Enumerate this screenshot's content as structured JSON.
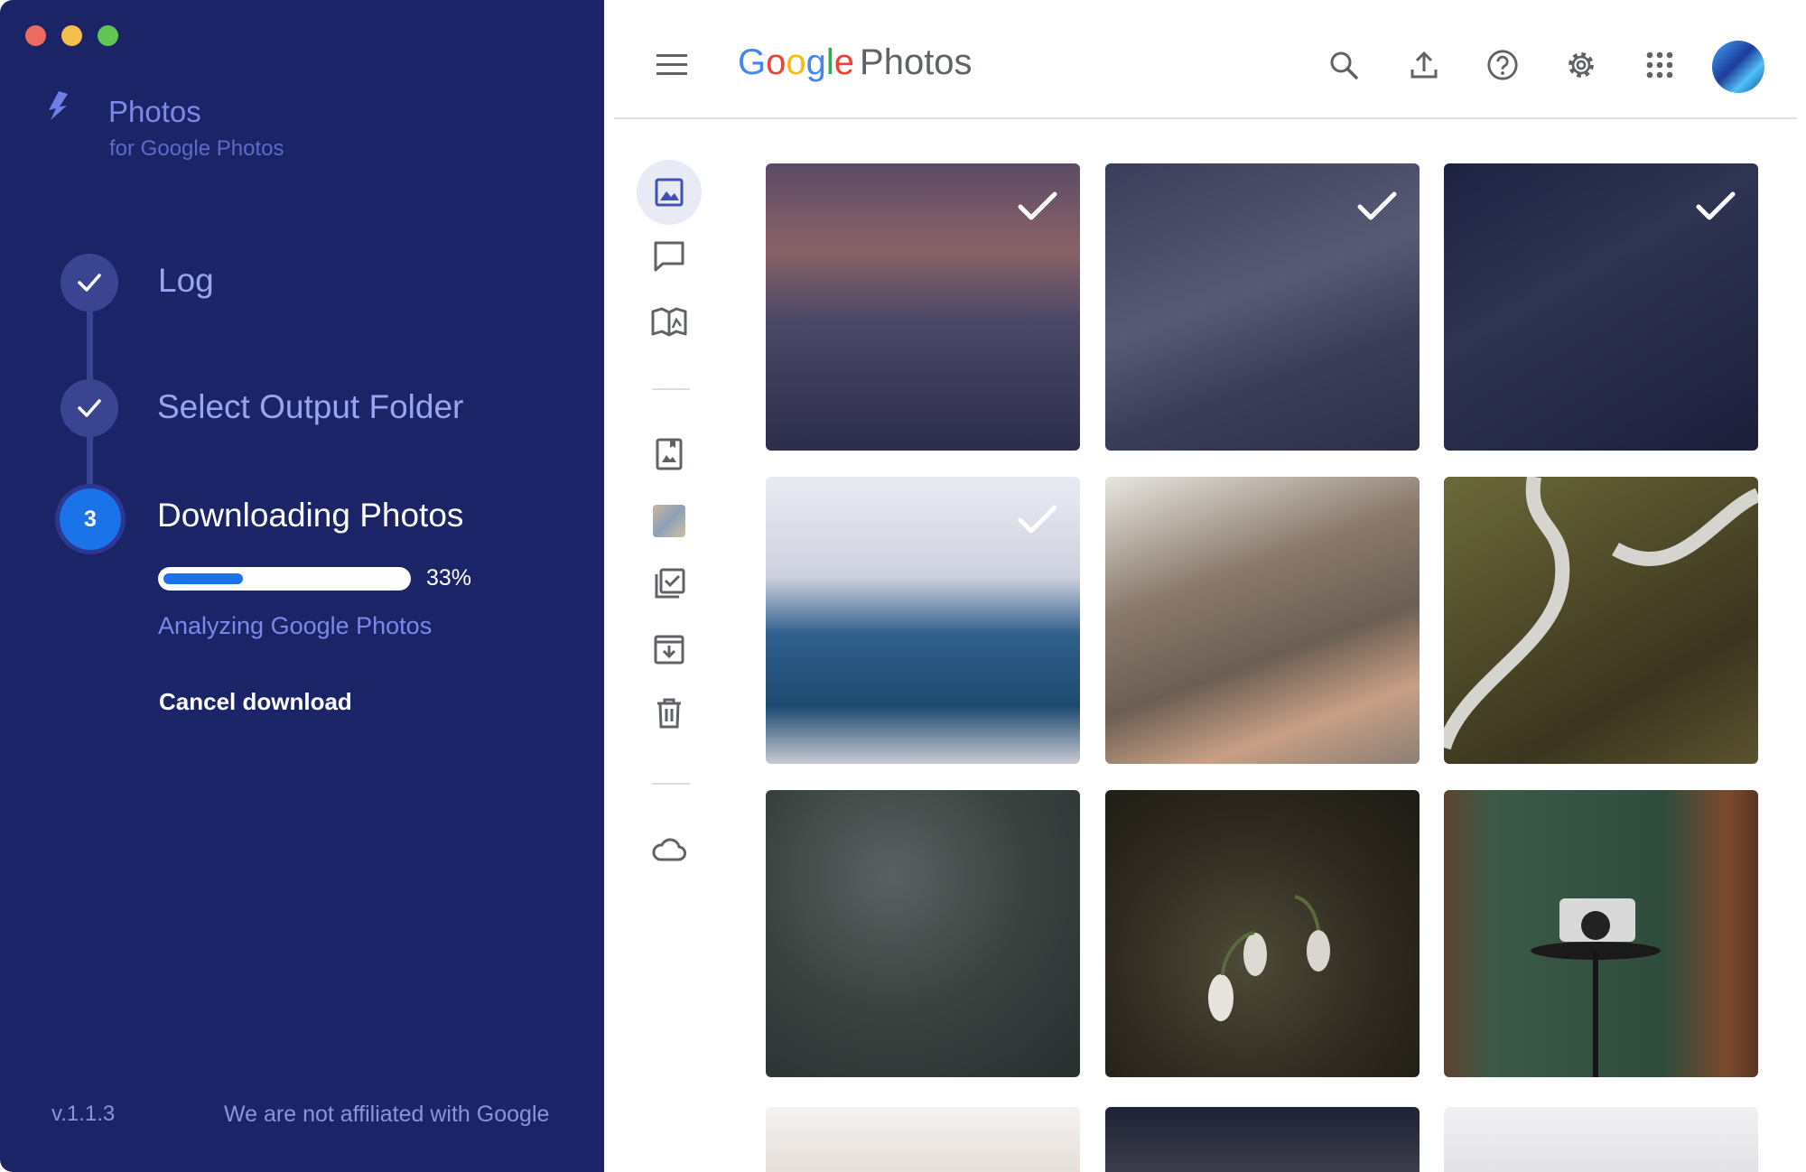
{
  "app": {
    "name": "Photos",
    "subtitle": "for Google Photos",
    "version": "v.1.1.3",
    "disclaimer": "We are not affiliated with Google"
  },
  "steps": [
    {
      "label": "Log",
      "state": "done"
    },
    {
      "label": "Select Output Folder",
      "state": "done"
    },
    {
      "label": "Downloading Photos",
      "state": "active",
      "number": "3"
    }
  ],
  "progress": {
    "fraction": 0.33,
    "label": "33%",
    "status": "Analyzing Google Photos",
    "cancel_label": "Cancel download"
  },
  "browser": {
    "logo_word": "Google",
    "logo_product": "Photos",
    "toolbar_icons": [
      "search-icon",
      "upload-icon",
      "help-icon",
      "settings-icon",
      "apps-grid-icon",
      "account-avatar"
    ],
    "nav_icons": [
      "photos-icon",
      "sharing-icon",
      "albums-icon",
      "photo-books-icon",
      "utilities-thumbnail",
      "assistant-icon",
      "archive-icon",
      "trash-icon",
      "cloud-storage-icon"
    ]
  },
  "photos": [
    {
      "name": "sunset-coast",
      "selected": true
    },
    {
      "name": "jeep-road",
      "selected": true
    },
    {
      "name": "camera-screen",
      "selected": true
    },
    {
      "name": "stairs",
      "selected": true
    },
    {
      "name": "feet-sand",
      "selected": false
    },
    {
      "name": "winding-road",
      "selected": false
    },
    {
      "name": "rain-glass",
      "selected": false
    },
    {
      "name": "snowdrops",
      "selected": false
    },
    {
      "name": "camera-table",
      "selected": false
    }
  ],
  "colors": {
    "panel": "#1c2468",
    "accent": "#1a73e8",
    "muted_text": "#7d88e8"
  }
}
